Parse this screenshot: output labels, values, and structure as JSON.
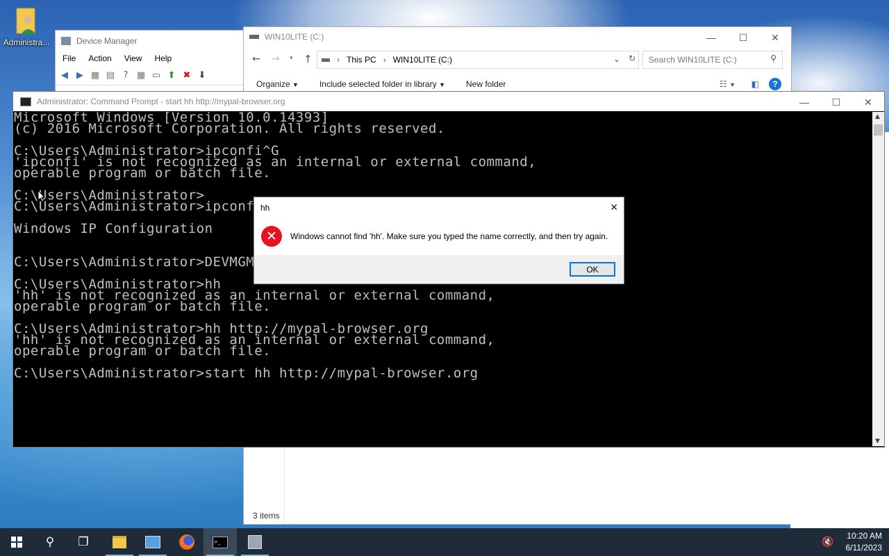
{
  "desktop": {
    "icon_label": "Administra..."
  },
  "device_manager": {
    "title": "Device Manager",
    "menu": [
      "File",
      "Action",
      "View",
      "Help"
    ]
  },
  "explorer": {
    "title": "WIN10LITE (C:)",
    "breadcrumb": [
      "This PC",
      "WIN10LITE (C:)"
    ],
    "search_placeholder": "Search WIN10LITE (C:)",
    "commands": {
      "organize": "Organize",
      "include": "Include selected folder in library",
      "new_folder": "New folder"
    },
    "status": "3 items"
  },
  "cmd": {
    "title": "Administrator: Command Prompt - start  hh http://mypal-browser.org",
    "lines": [
      "Microsoft Windows [Version 10.0.14393]",
      "(c) 2016 Microsoft Corporation. All rights reserved.",
      "",
      "C:\\Users\\Administrator>ipconfi^G",
      "'ipconfi' is not recognized as an internal or external command,",
      "operable program or batch file.",
      "",
      "C:\\Users\\Administrator>",
      "C:\\Users\\Administrator>ipconfig",
      "",
      "Windows IP Configuration",
      "",
      "",
      "C:\\Users\\Administrator>DEVMGMT.MSC",
      "",
      "C:\\Users\\Administrator>hh",
      "'hh' is not recognized as an internal or external command,",
      "operable program or batch file.",
      "",
      "C:\\Users\\Administrator>hh http://mypal-browser.org",
      "'hh' is not recognized as an internal or external command,",
      "operable program or batch file.",
      "",
      "C:\\Users\\Administrator>start hh http://mypal-browser.org"
    ]
  },
  "dialog": {
    "title": "hh",
    "message": "Windows cannot find 'hh'. Make sure you typed the name correctly, and then try again.",
    "ok_label": "OK"
  },
  "taskbar": {
    "time": "10:20 AM",
    "date": "6/11/2023"
  },
  "colors": {
    "taskbar_bg": "#1f2b38",
    "accent": "#0078d7",
    "error_red": "#e81123"
  }
}
